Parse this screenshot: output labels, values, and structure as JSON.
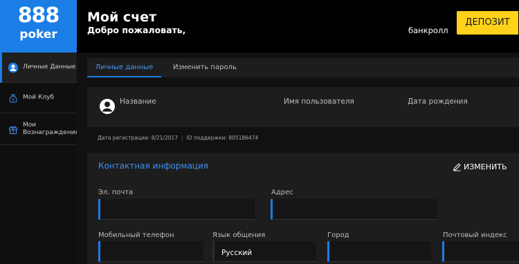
{
  "brand": {
    "logo_main": "888",
    "logo_sub": "poker"
  },
  "header": {
    "title": "Мой счет",
    "welcome": "Добро пожаловать,",
    "bankroll_label": "банкролл",
    "deposit_button": "ДЕПОЗИТ"
  },
  "sidebar": {
    "items": [
      {
        "label": "Личные Данные",
        "icon": "user-circle-icon",
        "active": true
      },
      {
        "label": "Мой Клуб",
        "icon": "moneybag-icon",
        "active": false
      },
      {
        "label": "Мои\nВознаграждения",
        "icon": "gift-icon",
        "active": false
      }
    ]
  },
  "tabs": [
    {
      "label": "Личные данные",
      "active": true
    },
    {
      "label": "Изменить пароль",
      "active": false
    }
  ],
  "profile": {
    "name_label": "Название",
    "username_label": "Имя пользователя",
    "dob_label": "Дата рождения"
  },
  "meta": {
    "registration": "Дата регистрации: 8/21/2017",
    "support_id": "ID поддержки: 805186474"
  },
  "contact": {
    "title": "Контактная информация",
    "edit_button": "ИЗМЕНИТЬ",
    "email_label": "Эл. почта",
    "address_label": "Адрес",
    "mobile_label": "Мобильный телефон",
    "language_label": "Язык общения",
    "language_value": "Русский",
    "city_label": "Город",
    "postal_label": "Почтовый индекс"
  },
  "colors": {
    "accent": "#1b7ee6",
    "deposit": "#ffd21a",
    "link": "#3f8ff0"
  }
}
